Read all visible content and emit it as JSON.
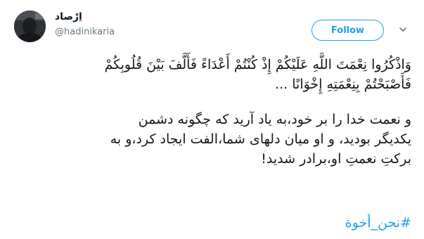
{
  "author": {
    "display_name": "اِرْصاد",
    "handle": "@hadinikaria"
  },
  "actions": {
    "follow_label": "Follow"
  },
  "icons": {
    "avatar": "profile-photo",
    "caret": "chevron-down-icon"
  },
  "colors": {
    "accent": "#1da1f2",
    "text": "#14171a",
    "muted": "#657786"
  },
  "tweet": {
    "verse": "وَاذْكُرُوا نِعْمَتَ اللَّهِ عَلَيْكُمْ إِذْ كُنْتُمْ أَعْدَاءً فَأَلَّفَ بَيْنَ قُلُوبِكُمْ\nفَأَصْبَحْتُمْ بِنِعْمَتِهِ إِخْوَانًا ...",
    "translation": "و نعمت خدا را بر خود،به یاد آرید که چگونه دشمن\nیکدیگر بودید، و او میان دلهای شما،الفت ایجاد کرد،و به\nبرکتِ نعمتِ او،برادر شدید!",
    "hashtag": "#نحن_أخوة"
  }
}
